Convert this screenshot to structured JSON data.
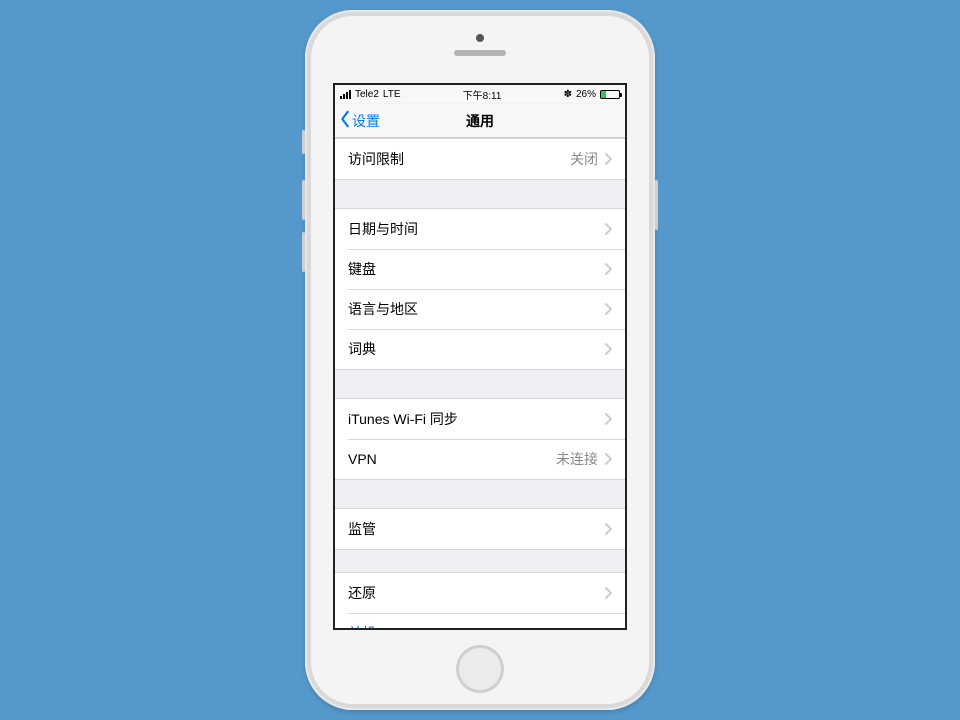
{
  "status": {
    "carrier": "Tele2",
    "network": "LTE",
    "time": "下午8:11",
    "battery_pct": "26%",
    "battery_fill_pct": 26
  },
  "nav": {
    "back_label": "设置",
    "title": "通用"
  },
  "group1": {
    "row0": {
      "label": "访问限制",
      "value": "关闭"
    }
  },
  "group2": {
    "row0": {
      "label": "日期与时间"
    },
    "row1": {
      "label": "键盘"
    },
    "row2": {
      "label": "语言与地区"
    },
    "row3": {
      "label": "词典"
    }
  },
  "group3": {
    "row0": {
      "label": "iTunes Wi-Fi 同步"
    },
    "row1": {
      "label": "VPN",
      "value": "未连接"
    }
  },
  "group4": {
    "row0": {
      "label": "监管"
    }
  },
  "group5": {
    "row0": {
      "label": "还原"
    },
    "row1": {
      "label": "关机"
    }
  }
}
